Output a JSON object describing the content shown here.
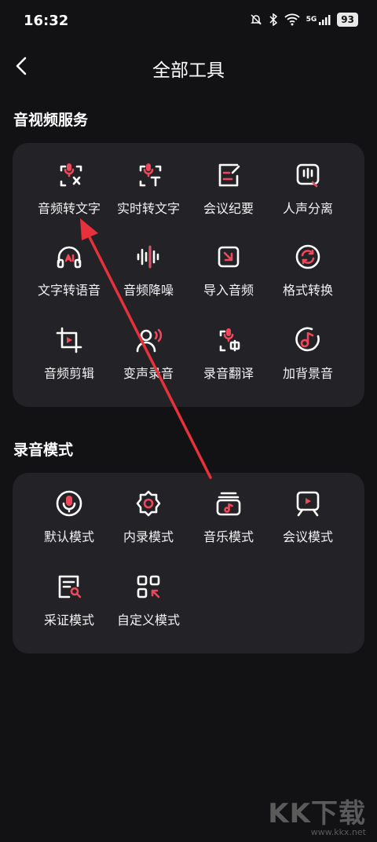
{
  "status": {
    "time": "16:32",
    "battery": "93",
    "network": "5G"
  },
  "header": {
    "title": "全部工具"
  },
  "sections": [
    {
      "title": "音视频服务",
      "tools": [
        {
          "label": "音频转文字",
          "icon": "mic-text-icon"
        },
        {
          "label": "实时转文字",
          "icon": "mic-realtime-icon"
        },
        {
          "label": "会议纪要",
          "icon": "meeting-notes-icon"
        },
        {
          "label": "人声分离",
          "icon": "voice-separate-icon"
        },
        {
          "label": "文字转语音",
          "icon": "headphones-ai-icon"
        },
        {
          "label": "音频降噪",
          "icon": "waveform-icon"
        },
        {
          "label": "导入音频",
          "icon": "import-icon"
        },
        {
          "label": "格式转换",
          "icon": "convert-icon"
        },
        {
          "label": "音频剪辑",
          "icon": "crop-play-icon"
        },
        {
          "label": "变声录音",
          "icon": "voice-change-icon"
        },
        {
          "label": "录音翻译",
          "icon": "mic-translate-icon"
        },
        {
          "label": "加背景音",
          "icon": "music-note-icon"
        }
      ]
    },
    {
      "title": "录音模式",
      "tools": [
        {
          "label": "默认模式",
          "icon": "mic-circle-icon"
        },
        {
          "label": "内录模式",
          "icon": "gear-mic-icon"
        },
        {
          "label": "音乐模式",
          "icon": "music-stack-icon"
        },
        {
          "label": "会议模式",
          "icon": "presentation-icon"
        },
        {
          "label": "采证模式",
          "icon": "evidence-search-icon"
        },
        {
          "label": "自定义模式",
          "icon": "custom-grid-icon"
        }
      ]
    }
  ],
  "watermark": {
    "big": "KK下载",
    "small": "www.kkx.net"
  },
  "colors": {
    "accent": "#f0475a",
    "card": "#232327",
    "background": "#121215"
  }
}
